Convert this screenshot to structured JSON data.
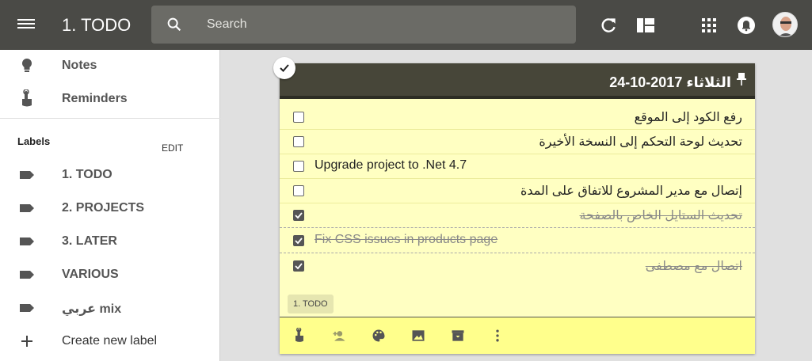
{
  "app": {
    "title": "1. TODO"
  },
  "search": {
    "placeholder": "Search"
  },
  "toolbar": {
    "icons": [
      "menu-icon",
      "search-icon",
      "refresh-icon",
      "list-view-icon",
      "apps-icon",
      "notifications-icon",
      "account-avatar"
    ]
  },
  "sidebar": {
    "items": [
      {
        "label": "Notes",
        "icon": "lightbulb-icon"
      },
      {
        "label": "Reminders",
        "icon": "reminder-icon"
      }
    ],
    "labels_heading": "Labels",
    "edit_label": "EDIT",
    "labels": [
      {
        "label": "1. TODO"
      },
      {
        "label": "2. PROJECTS"
      },
      {
        "label": "3. LATER"
      },
      {
        "label": "VARIOUS"
      },
      {
        "label": "عربي mix"
      }
    ],
    "create_label": "Create new label"
  },
  "note": {
    "title": "الثلاثاء 2017-10-24",
    "items": [
      {
        "text": "رفع الكود إلى الموقع",
        "checked": false
      },
      {
        "text": "تحديث لوحة التحكم إلى النسخة الأخيرة",
        "checked": false
      },
      {
        "text": "Upgrade project to .Net 4.7",
        "checked": false
      },
      {
        "text": "إتصال مع مدير المشروع للاتفاق على المدة",
        "checked": false
      },
      {
        "text": "تحديث الستايل الخاص بالصفحة",
        "checked": true
      },
      {
        "text": "Fix CSS issues in products page",
        "checked": true
      },
      {
        "text": "اتصال مع مصطفى",
        "checked": true
      }
    ],
    "label_chip": "1. TODO",
    "footer_icons": [
      "reminder-icon",
      "collaborator-icon",
      "palette-icon",
      "image-icon",
      "archive-icon",
      "more-icon"
    ]
  },
  "colors": {
    "topbar": "#4a4a46",
    "note_header": "#474639",
    "note_body": "#ffffc2",
    "note_footer": "#ffff8c"
  }
}
